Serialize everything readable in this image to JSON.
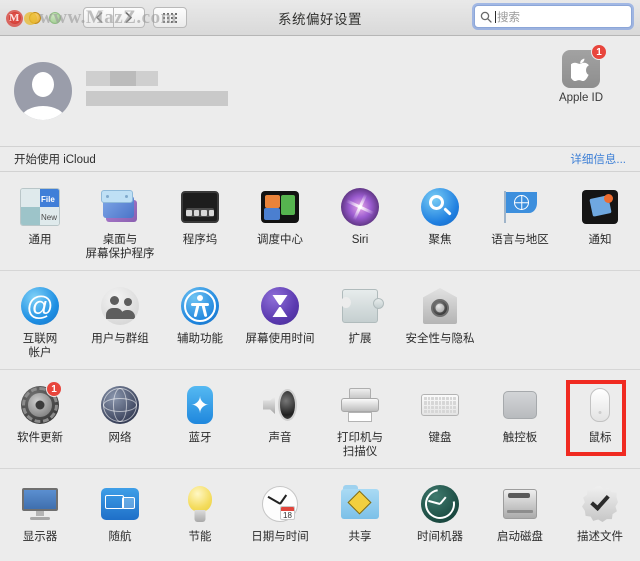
{
  "window": {
    "title": "系统偏好设置",
    "traffic_lights": [
      "close-button",
      "minimize-button",
      "zoom-button"
    ],
    "nav": {
      "back_label": "‹",
      "forward_label": "›",
      "grid_label": "show-all-grid"
    },
    "watermark": "www.MazZ.com"
  },
  "search": {
    "placeholder": "搜索",
    "value": "",
    "icon": "search-icon"
  },
  "account": {
    "avatar": "default-user-avatar",
    "name_redacted": true,
    "apple_id": {
      "label": "Apple ID",
      "icon": "apple-logo-icon",
      "badge": "1"
    }
  },
  "icloud": {
    "text": "开始使用 iCloud",
    "link": "详细信息...",
    "link_color": "#3d7fd6"
  },
  "highlight": {
    "target": "鼠标",
    "color": "#f02a21"
  },
  "sections": [
    {
      "name": "personal-row-1",
      "items": [
        {
          "label": "通用",
          "icon": "general-icon",
          "art": "general"
        },
        {
          "label": "桌面与\n屏幕保护程序",
          "icon": "desktop-screensaver-icon",
          "art": "desk"
        },
        {
          "label": "程序坞",
          "icon": "dock-icon",
          "art": "dock"
        },
        {
          "label": "调度中心",
          "icon": "mission-control-icon",
          "art": "mc"
        },
        {
          "label": "Siri",
          "icon": "siri-icon",
          "art": "siri"
        },
        {
          "label": "聚焦",
          "icon": "spotlight-icon",
          "art": "spot"
        },
        {
          "label": "语言与地区",
          "icon": "language-region-icon",
          "art": "flag"
        },
        {
          "label": "通知",
          "icon": "notifications-icon",
          "art": "notif"
        }
      ]
    },
    {
      "name": "personal-row-2",
      "items": [
        {
          "label": "互联网\n帐户",
          "icon": "internet-accounts-icon",
          "art": "at"
        },
        {
          "label": "用户与群组",
          "icon": "users-groups-icon",
          "art": "users"
        },
        {
          "label": "辅助功能",
          "icon": "accessibility-icon",
          "art": "acc"
        },
        {
          "label": "屏幕使用时间",
          "icon": "screen-time-icon",
          "art": "st"
        },
        {
          "label": "扩展",
          "icon": "extensions-icon",
          "art": "ext"
        },
        {
          "label": "安全性与隐私",
          "icon": "security-privacy-icon",
          "art": "sec"
        }
      ]
    },
    {
      "name": "hardware-row",
      "items": [
        {
          "label": "软件更新",
          "icon": "software-update-icon",
          "art": "gear",
          "badge": "1"
        },
        {
          "label": "网络",
          "icon": "network-icon",
          "art": "net"
        },
        {
          "label": "蓝牙",
          "icon": "bluetooth-icon",
          "art": "bt",
          "glyph": "✦"
        },
        {
          "label": "声音",
          "icon": "sound-icon",
          "art": "snd"
        },
        {
          "label": "打印机与\n扫描仪",
          "icon": "printers-scanners-icon",
          "art": "prn"
        },
        {
          "label": "键盘",
          "icon": "keyboard-icon",
          "art": "kbd"
        },
        {
          "label": "触控板",
          "icon": "trackpad-icon",
          "art": "tp"
        },
        {
          "label": "鼠标",
          "icon": "mouse-icon",
          "art": "mouse",
          "highlighted": true
        }
      ]
    },
    {
      "name": "system-row",
      "items": [
        {
          "label": "显示器",
          "icon": "displays-icon",
          "art": "disp"
        },
        {
          "label": "随航",
          "icon": "sidecar-icon",
          "art": "side"
        },
        {
          "label": "节能",
          "icon": "energy-saver-icon",
          "art": "bulb"
        },
        {
          "label": "日期与时间",
          "icon": "date-time-icon",
          "art": "clock",
          "day": "18"
        },
        {
          "label": "共享",
          "icon": "sharing-icon",
          "art": "share"
        },
        {
          "label": "时间机器",
          "icon": "time-machine-icon",
          "art": "tm"
        },
        {
          "label": "启动磁盘",
          "icon": "startup-disk-icon",
          "art": "disk"
        },
        {
          "label": "描述文件",
          "icon": "profiles-icon",
          "art": "prof"
        }
      ]
    }
  ]
}
